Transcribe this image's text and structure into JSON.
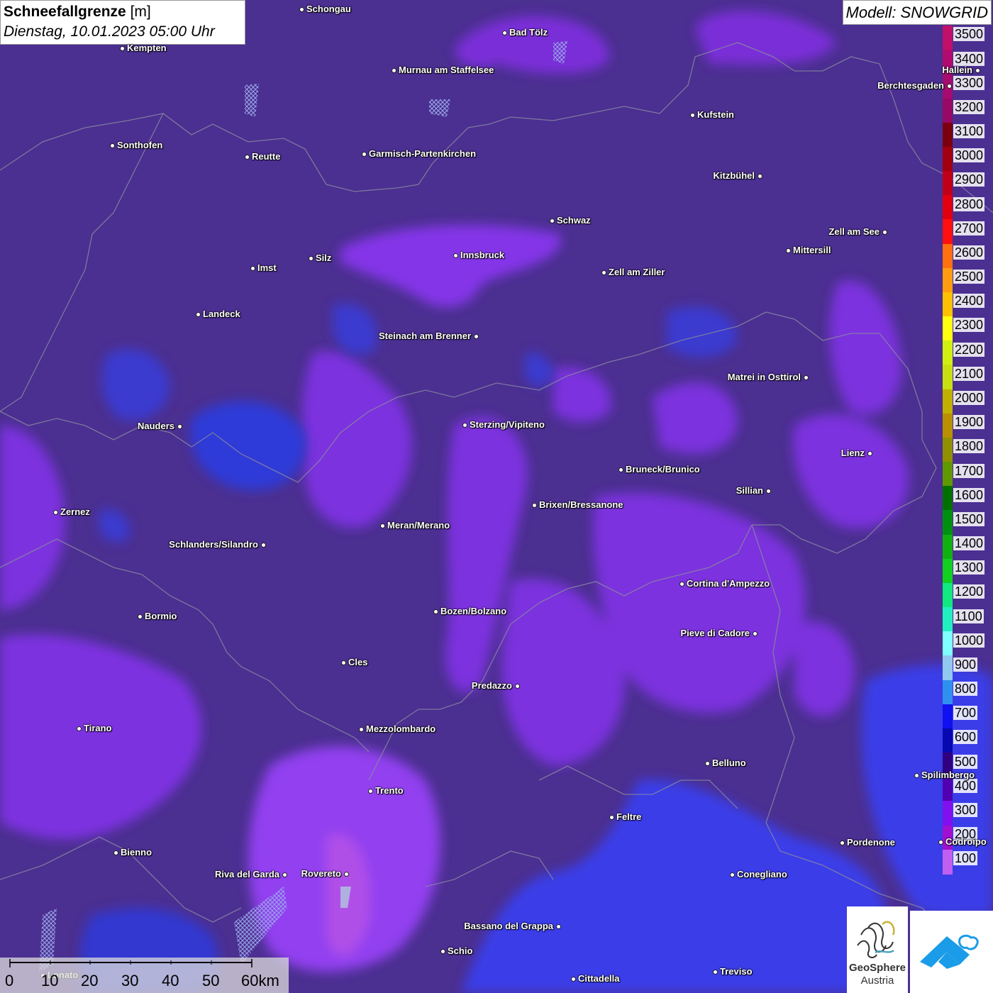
{
  "header": {
    "title": "Schneefallgrenze",
    "unit": "[m]",
    "datetime": "Dienstag, 10.01.2023 05:00 Uhr",
    "model": "Modell: SNOWGRID"
  },
  "legend": {
    "items": [
      {
        "label": "3500",
        "color": "#c0106a"
      },
      {
        "label": "3400",
        "color": "#b00c70"
      },
      {
        "label": "3300",
        "color": "#a50c6e"
      },
      {
        "label": "3200",
        "color": "#960a66"
      },
      {
        "label": "3100",
        "color": "#7a0010"
      },
      {
        "label": "3000",
        "color": "#a00010"
      },
      {
        "label": "2900",
        "color": "#c00018"
      },
      {
        "label": "2800",
        "color": "#e00010"
      },
      {
        "label": "2700",
        "color": "#ff1010"
      },
      {
        "label": "2600",
        "color": "#ff7010"
      },
      {
        "label": "2500",
        "color": "#ff9c10"
      },
      {
        "label": "2400",
        "color": "#ffc000"
      },
      {
        "label": "2300",
        "color": "#ffff10"
      },
      {
        "label": "2200",
        "color": "#d0f010"
      },
      {
        "label": "2100",
        "color": "#c8e010"
      },
      {
        "label": "2000",
        "color": "#c0b000"
      },
      {
        "label": "1900",
        "color": "#b89000"
      },
      {
        "label": "1800",
        "color": "#909000"
      },
      {
        "label": "1700",
        "color": "#609800"
      },
      {
        "label": "1600",
        "color": "#007000"
      },
      {
        "label": "1500",
        "color": "#009010"
      },
      {
        "label": "1400",
        "color": "#10b010"
      },
      {
        "label": "1300",
        "color": "#10d020"
      },
      {
        "label": "1200",
        "color": "#10e880"
      },
      {
        "label": "1100",
        "color": "#20f0c0"
      },
      {
        "label": "1000",
        "color": "#80ffff"
      },
      {
        "label": "900",
        "color": "#90c8f0"
      },
      {
        "label": "800",
        "color": "#3090f0"
      },
      {
        "label": "700",
        "color": "#1010f0"
      },
      {
        "label": "600",
        "color": "#0808b0"
      },
      {
        "label": "500",
        "color": "#300080"
      },
      {
        "label": "400",
        "color": "#5000b0"
      },
      {
        "label": "300",
        "color": "#8010f0"
      },
      {
        "label": "200",
        "color": "#a010d0"
      },
      {
        "label": "100",
        "color": "#c060f0"
      }
    ]
  },
  "cities": [
    {
      "name": "Schongau"
    },
    {
      "name": "Kempten"
    },
    {
      "name": "Bad Tölz"
    },
    {
      "name": "Murnau am Staffelsee"
    },
    {
      "name": "Hallein"
    },
    {
      "name": "Berchtesgaden"
    },
    {
      "name": "Kufstein"
    },
    {
      "name": "Sonthofen"
    },
    {
      "name": "Reutte"
    },
    {
      "name": "Garmisch-Partenkirchen"
    },
    {
      "name": "Kitzbühel"
    },
    {
      "name": "Schwaz"
    },
    {
      "name": "Zell am See"
    },
    {
      "name": "Innsbruck"
    },
    {
      "name": "Mittersill"
    },
    {
      "name": "Imst"
    },
    {
      "name": "Silz"
    },
    {
      "name": "Zell am Ziller"
    },
    {
      "name": "Landeck"
    },
    {
      "name": "Steinach am Brenner"
    },
    {
      "name": "Matrei in Osttirol"
    },
    {
      "name": "Nauders"
    },
    {
      "name": "Sterzing/Vipiteno"
    },
    {
      "name": "Lienz"
    },
    {
      "name": "Bruneck/Brunico"
    },
    {
      "name": "Sillian"
    },
    {
      "name": "Zernez"
    },
    {
      "name": "Brixen/Bressanone"
    },
    {
      "name": "Meran/Merano"
    },
    {
      "name": "Schlanders/Silandro"
    },
    {
      "name": "Cortina d'Ampezzo"
    },
    {
      "name": "Bozen/Bolzano"
    },
    {
      "name": "Bormio"
    },
    {
      "name": "Pieve di Cadore"
    },
    {
      "name": "Cles"
    },
    {
      "name": "Predazzo"
    },
    {
      "name": "Tirano"
    },
    {
      "name": "Mezzolombardo"
    },
    {
      "name": "Belluno"
    },
    {
      "name": "Spilimbergo"
    },
    {
      "name": "Trento"
    },
    {
      "name": "Feltre"
    },
    {
      "name": "Pordenone"
    },
    {
      "name": "Codroipo"
    },
    {
      "name": "Bienno"
    },
    {
      "name": "Riva del Garda"
    },
    {
      "name": "Rovereto"
    },
    {
      "name": "Conegliano"
    },
    {
      "name": "Bassano del Grappa"
    },
    {
      "name": "Schio"
    },
    {
      "name": "Treviso"
    },
    {
      "name": "Lonato"
    },
    {
      "name": "Cittadella"
    }
  ],
  "scale_bar": {
    "labels": [
      "0",
      "10",
      "20",
      "30",
      "40",
      "50",
      "60km"
    ]
  },
  "logos": {
    "geosphere_line1": "GeoSphere",
    "geosphere_line2": "Austria"
  }
}
